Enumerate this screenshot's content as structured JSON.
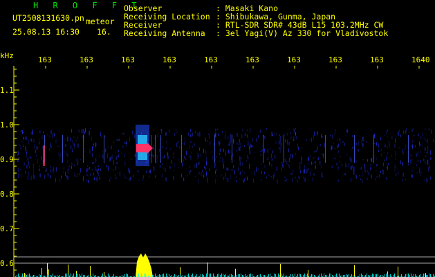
{
  "header": {
    "brand": "H R O F F T",
    "filename": "UT2508131630.pn",
    "meteor_tag": "meteor",
    "datetime": "25.08.13 16:30",
    "minute_field": "16.",
    "fields": [
      {
        "label": "Observer",
        "value": ": Masaki Kano"
      },
      {
        "label": "Receiving Location",
        "value": ": Shibukawa, Gunma, Japan"
      },
      {
        "label": "Receiver",
        "value": ": RTL-SDR SDR# 43dB L15 103.2MHz CW"
      },
      {
        "label": "Receiving Antenna",
        "value": ": 3el Yagi(V) Az 330 for Vladivostok"
      }
    ]
  },
  "x_axis": {
    "ticks": [
      "163",
      "163",
      "163",
      "163",
      "163",
      "163",
      "163",
      "163",
      "163",
      "1640"
    ]
  },
  "y_axis": {
    "unit": "kHz",
    "ticks": [
      "1.1",
      "1.0",
      "0.9",
      "0.8",
      "0.7",
      "0.6"
    ]
  },
  "colors": {
    "text": "#ffff00",
    "brand": "#00e000",
    "noise": "#2233ff",
    "echo": "#ff3366",
    "meter": "#ffff00",
    "meter_base": "#00ffff",
    "ref_lines": "#aaaaaa"
  }
}
